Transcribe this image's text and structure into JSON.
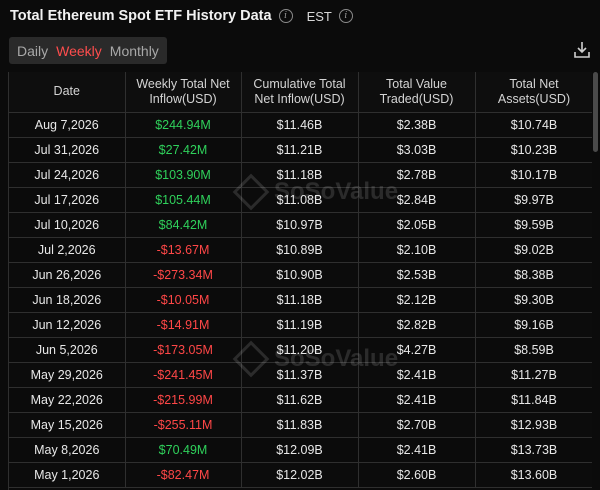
{
  "header": {
    "title": "Total Ethereum Spot ETF History Data",
    "timezone": "EST"
  },
  "tabs": [
    {
      "label": "Daily",
      "active": false
    },
    {
      "label": "Weekly",
      "active": true
    },
    {
      "label": "Monthly",
      "active": false
    }
  ],
  "columns": [
    "Date",
    "Weekly Total Net Inflow(USD)",
    "Cumulative Total Net Inflow(USD)",
    "Total Value Traded(USD)",
    "Total Net Assets(USD)"
  ],
  "rows": [
    {
      "date": "Aug 7,2026",
      "inflow": "$244.94M",
      "dir": "pos",
      "cumulative": "$11.46B",
      "traded": "$2.38B",
      "assets": "$10.74B"
    },
    {
      "date": "Jul 31,2026",
      "inflow": "$27.42M",
      "dir": "pos",
      "cumulative": "$11.21B",
      "traded": "$3.03B",
      "assets": "$10.23B"
    },
    {
      "date": "Jul 24,2026",
      "inflow": "$103.90M",
      "dir": "pos",
      "cumulative": "$11.18B",
      "traded": "$2.78B",
      "assets": "$10.17B"
    },
    {
      "date": "Jul 17,2026",
      "inflow": "$105.44M",
      "dir": "pos",
      "cumulative": "$11.08B",
      "traded": "$2.84B",
      "assets": "$9.97B"
    },
    {
      "date": "Jul 10,2026",
      "inflow": "$84.42M",
      "dir": "pos",
      "cumulative": "$10.97B",
      "traded": "$2.05B",
      "assets": "$9.59B"
    },
    {
      "date": "Jul 2,2026",
      "inflow": "-$13.67M",
      "dir": "neg",
      "cumulative": "$10.89B",
      "traded": "$2.10B",
      "assets": "$9.02B"
    },
    {
      "date": "Jun 26,2026",
      "inflow": "-$273.34M",
      "dir": "neg",
      "cumulative": "$10.90B",
      "traded": "$2.53B",
      "assets": "$8.38B"
    },
    {
      "date": "Jun 18,2026",
      "inflow": "-$10.05M",
      "dir": "neg",
      "cumulative": "$11.18B",
      "traded": "$2.12B",
      "assets": "$9.30B"
    },
    {
      "date": "Jun 12,2026",
      "inflow": "-$14.91M",
      "dir": "neg",
      "cumulative": "$11.19B",
      "traded": "$2.82B",
      "assets": "$9.16B"
    },
    {
      "date": "Jun 5,2026",
      "inflow": "-$173.05M",
      "dir": "neg",
      "cumulative": "$11.20B",
      "traded": "$4.27B",
      "assets": "$8.59B"
    },
    {
      "date": "May 29,2026",
      "inflow": "-$241.45M",
      "dir": "neg",
      "cumulative": "$11.37B",
      "traded": "$2.41B",
      "assets": "$11.27B"
    },
    {
      "date": "May 22,2026",
      "inflow": "-$215.99M",
      "dir": "neg",
      "cumulative": "$11.62B",
      "traded": "$2.41B",
      "assets": "$11.84B"
    },
    {
      "date": "May 15,2026",
      "inflow": "-$255.11M",
      "dir": "neg",
      "cumulative": "$11.83B",
      "traded": "$2.70B",
      "assets": "$12.93B"
    },
    {
      "date": "May 8,2026",
      "inflow": "$70.49M",
      "dir": "pos",
      "cumulative": "$12.09B",
      "traded": "$2.41B",
      "assets": "$13.73B"
    },
    {
      "date": "May 1,2026",
      "inflow": "-$82.47M",
      "dir": "neg",
      "cumulative": "$12.02B",
      "traded": "$2.60B",
      "assets": "$13.60B"
    }
  ],
  "watermark": "SoSoValue",
  "colors": {
    "positive": "#2fd15b",
    "negative": "#ff4747",
    "active_tab": "#ff4d4d",
    "background": "#0b0b0b"
  },
  "icons": {
    "info": "info-icon",
    "download": "download-icon"
  }
}
